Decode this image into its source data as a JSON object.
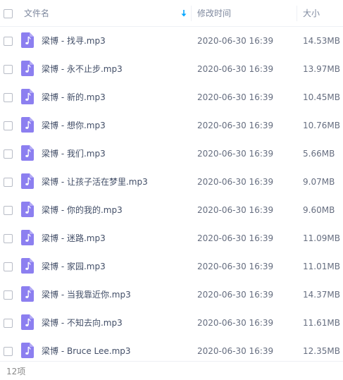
{
  "header": {
    "name_label": "文件名",
    "time_label": "修改时间",
    "size_label": "大小"
  },
  "icons": {
    "file": "music-file-icon",
    "sort": "sort-down-arrow-icon"
  },
  "colors": {
    "icon_purple": "#8c7ff0",
    "sort_blue": "#06a7ff"
  },
  "files": [
    {
      "name": "梁博 - 找寻.mp3",
      "time": "2020-06-30 16:39",
      "size": "14.53MB"
    },
    {
      "name": "梁博 - 永不止步.mp3",
      "time": "2020-06-30 16:39",
      "size": "13.97MB"
    },
    {
      "name": "梁博 - 新的.mp3",
      "time": "2020-06-30 16:39",
      "size": "10.45MB"
    },
    {
      "name": "梁博 - 想你.mp3",
      "time": "2020-06-30 16:39",
      "size": "10.76MB"
    },
    {
      "name": "梁博 - 我们.mp3",
      "time": "2020-06-30 16:39",
      "size": "5.66MB"
    },
    {
      "name": "梁博 - 让孩子活在梦里.mp3",
      "time": "2020-06-30 16:39",
      "size": "9.07MB"
    },
    {
      "name": "梁博 - 你的我的.mp3",
      "time": "2020-06-30 16:39",
      "size": "9.60MB"
    },
    {
      "name": "梁博 - 迷路.mp3",
      "time": "2020-06-30 16:39",
      "size": "11.09MB"
    },
    {
      "name": "梁博 - 家园.mp3",
      "time": "2020-06-30 16:39",
      "size": "11.01MB"
    },
    {
      "name": "梁博 - 当我靠近你.mp3",
      "time": "2020-06-30 16:39",
      "size": "14.37MB"
    },
    {
      "name": "梁博 - 不知去向.mp3",
      "time": "2020-06-30 16:39",
      "size": "11.61MB"
    },
    {
      "name": "梁博 - Bruce Lee.mp3",
      "time": "2020-06-30 16:39",
      "size": "12.35MB"
    }
  ],
  "footer": {
    "count": "12项"
  }
}
